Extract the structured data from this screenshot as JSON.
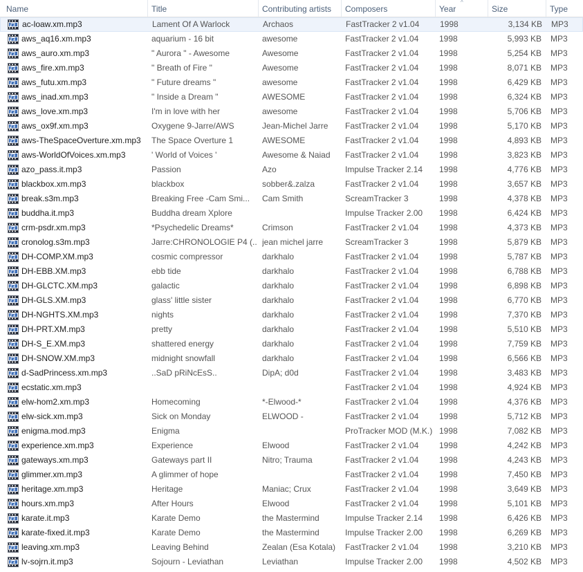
{
  "columns": {
    "name": "Name",
    "title": "Title",
    "artists": "Contributing artists",
    "composers": "Composers",
    "year": "Year",
    "size": "Size",
    "type": "Type"
  },
  "sort_indicator": "^",
  "file_icon": "audio-file-icon",
  "rows": [
    {
      "name": "ac-loaw.xm.mp3",
      "title": "Lament Of A Warlock",
      "artist": "Archaos",
      "composer": "FastTracker 2 v1.04",
      "year": "1998",
      "size": "3,134 KB",
      "type": "MP3"
    },
    {
      "name": "aws_aq16.xm.mp3",
      "title": "aquarium - 16 bit",
      "artist": "awesome",
      "composer": "FastTracker 2 v1.04",
      "year": "1998",
      "size": "5,993 KB",
      "type": "MP3"
    },
    {
      "name": "aws_auro.xm.mp3",
      "title": "\" Aurora \" - Awesome",
      "artist": "Awesome",
      "composer": "FastTracker 2 v1.04",
      "year": "1998",
      "size": "5,254 KB",
      "type": "MP3"
    },
    {
      "name": "aws_fire.xm.mp3",
      "title": "\" Breath of Fire \"",
      "artist": "Awesome",
      "composer": "FastTracker 2 v1.04",
      "year": "1998",
      "size": "8,071 KB",
      "type": "MP3"
    },
    {
      "name": "aws_futu.xm.mp3",
      "title": "\" Future dreams \"",
      "artist": "awesome",
      "composer": "FastTracker 2 v1.04",
      "year": "1998",
      "size": "6,429 KB",
      "type": "MP3"
    },
    {
      "name": "aws_inad.xm.mp3",
      "title": "\" Inside a Dream \"",
      "artist": "AWESOME",
      "composer": "FastTracker 2 v1.04",
      "year": "1998",
      "size": "6,324 KB",
      "type": "MP3"
    },
    {
      "name": "aws_love.xm.mp3",
      "title": "I'm in love with her",
      "artist": "awesome",
      "composer": "FastTracker 2 v1.04",
      "year": "1998",
      "size": "5,706 KB",
      "type": "MP3"
    },
    {
      "name": "aws_ox9f.xm.mp3",
      "title": "Oxygene 9-Jarre/AWS",
      "artist": "Jean-Michel Jarre",
      "composer": "FastTracker 2 v1.04",
      "year": "1998",
      "size": "5,170 KB",
      "type": "MP3"
    },
    {
      "name": "aws-TheSpaceOverture.xm.mp3",
      "title": "The Space Overture 1",
      "artist": "AWESOME",
      "composer": "FastTracker 2 v1.04",
      "year": "1998",
      "size": "4,893 KB",
      "type": "MP3"
    },
    {
      "name": "aws-WorldOfVoices.xm.mp3",
      "title": "' World of Voices '",
      "artist": "Awesome & Naiad",
      "composer": "FastTracker 2 v1.04",
      "year": "1998",
      "size": "3,823 KB",
      "type": "MP3"
    },
    {
      "name": "azo_pass.it.mp3",
      "title": "Passion",
      "artist": "Azo",
      "composer": "Impulse Tracker 2.14",
      "year": "1998",
      "size": "4,776 KB",
      "type": "MP3"
    },
    {
      "name": "blackbox.xm.mp3",
      "title": "blackbox",
      "artist": "sobber&.zalza",
      "composer": "FastTracker 2 v1.04",
      "year": "1998",
      "size": "3,657 KB",
      "type": "MP3"
    },
    {
      "name": "break.s3m.mp3",
      "title": "Breaking Free    -Cam Smi...",
      "artist": "Cam Smith",
      "composer": "ScreamTracker 3",
      "year": "1998",
      "size": "4,378 KB",
      "type": "MP3"
    },
    {
      "name": "buddha.it.mp3",
      "title": "Buddha dream       Xplore",
      "artist": "",
      "composer": "Impulse Tracker 2.00",
      "year": "1998",
      "size": "6,424 KB",
      "type": "MP3"
    },
    {
      "name": "crm-psdr.xm.mp3",
      "title": "*Psychedelic Dreams*",
      "artist": "Crimson",
      "composer": "FastTracker 2 v1.04",
      "year": "1998",
      "size": "4,373 KB",
      "type": "MP3"
    },
    {
      "name": "cronolog.s3m.mp3",
      "title": "Jarre:CHRONOLOGIE P4 (...",
      "artist": "jean michel jarre",
      "composer": "ScreamTracker 3",
      "year": "1998",
      "size": "5,879 KB",
      "type": "MP3"
    },
    {
      "name": "DH-COMP.XM.mp3",
      "title": "cosmic compressor",
      "artist": "darkhalo",
      "composer": "FastTracker 2 v1.04",
      "year": "1998",
      "size": "5,787 KB",
      "type": "MP3"
    },
    {
      "name": "DH-EBB.XM.mp3",
      "title": "ebb tide",
      "artist": "darkhalo",
      "composer": "FastTracker 2 v1.04",
      "year": "1998",
      "size": "6,788 KB",
      "type": "MP3"
    },
    {
      "name": "DH-GLCTC.XM.mp3",
      "title": "galactic",
      "artist": "darkhalo",
      "composer": "FastTracker 2 v1.04",
      "year": "1998",
      "size": "6,898 KB",
      "type": "MP3"
    },
    {
      "name": "DH-GLS.XM.mp3",
      "title": "glass' little sister",
      "artist": "darkhalo",
      "composer": "FastTracker 2 v1.04",
      "year": "1998",
      "size": "6,770 KB",
      "type": "MP3"
    },
    {
      "name": "DH-NGHTS.XM.mp3",
      "title": "nights",
      "artist": "darkhalo",
      "composer": "FastTracker 2 v1.04",
      "year": "1998",
      "size": "7,370 KB",
      "type": "MP3"
    },
    {
      "name": "DH-PRT.XM.mp3",
      "title": "pretty",
      "artist": "darkhalo",
      "composer": "FastTracker 2 v1.04",
      "year": "1998",
      "size": "5,510 KB",
      "type": "MP3"
    },
    {
      "name": "DH-S_E.XM.mp3",
      "title": "shattered energy",
      "artist": "darkhalo",
      "composer": "FastTracker 2 v1.04",
      "year": "1998",
      "size": "7,759 KB",
      "type": "MP3"
    },
    {
      "name": "DH-SNOW.XM.mp3",
      "title": "midnight snowfall",
      "artist": "darkhalo",
      "composer": "FastTracker 2 v1.04",
      "year": "1998",
      "size": "6,566 KB",
      "type": "MP3"
    },
    {
      "name": "d-SadPrincess.xm.mp3",
      "title": "..SaD pRiNcEsS..",
      "artist": "DipA; d0d",
      "composer": "FastTracker 2 v1.04",
      "year": "1998",
      "size": "3,483 KB",
      "type": "MP3"
    },
    {
      "name": "ecstatic.xm.mp3",
      "title": "",
      "artist": "",
      "composer": "FastTracker 2 v1.04",
      "year": "1998",
      "size": "4,924 KB",
      "type": "MP3"
    },
    {
      "name": "elw-hom2.xm.mp3",
      "title": "Homecoming",
      "artist": "*-Elwood-*",
      "composer": "FastTracker 2 v1.04",
      "year": "1998",
      "size": "4,376 KB",
      "type": "MP3"
    },
    {
      "name": "elw-sick.xm.mp3",
      "title": "Sick on Monday",
      "artist": "ELWOOD -",
      "composer": "FastTracker 2 v1.04",
      "year": "1998",
      "size": "5,712 KB",
      "type": "MP3"
    },
    {
      "name": "enigma.mod.mp3",
      "title": "Enigma",
      "artist": "",
      "composer": "ProTracker MOD (M.K.)",
      "year": "1998",
      "size": "7,082 KB",
      "type": "MP3"
    },
    {
      "name": "experience.xm.mp3",
      "title": "Experience",
      "artist": "Elwood",
      "composer": "FastTracker 2 v1.04",
      "year": "1998",
      "size": "4,242 KB",
      "type": "MP3"
    },
    {
      "name": "gateways.xm.mp3",
      "title": "Gateways part II",
      "artist": "Nitro; Trauma",
      "composer": "FastTracker 2 v1.04",
      "year": "1998",
      "size": "4,243 KB",
      "type": "MP3"
    },
    {
      "name": "glimmer.xm.mp3",
      "title": "A glimmer of hope",
      "artist": "",
      "composer": "FastTracker 2 v1.04",
      "year": "1998",
      "size": "7,450 KB",
      "type": "MP3"
    },
    {
      "name": "heritage.xm.mp3",
      "title": "Heritage",
      "artist": "Maniac; Crux",
      "composer": "FastTracker 2 v1.04",
      "year": "1998",
      "size": "3,649 KB",
      "type": "MP3"
    },
    {
      "name": "hours.xm.mp3",
      "title": "After Hours",
      "artist": "Elwood",
      "composer": "FastTracker 2 v1.04",
      "year": "1998",
      "size": "5,101 KB",
      "type": "MP3"
    },
    {
      "name": "karate.it.mp3",
      "title": "Karate Demo",
      "artist": "the Mastermind",
      "composer": "Impulse Tracker 2.14",
      "year": "1998",
      "size": "6,426 KB",
      "type": "MP3"
    },
    {
      "name": "karate-fixed.it.mp3",
      "title": "Karate Demo",
      "artist": "the Mastermind",
      "composer": "Impulse Tracker 2.00",
      "year": "1998",
      "size": "6,269 KB",
      "type": "MP3"
    },
    {
      "name": "leaving.xm.mp3",
      "title": "Leaving Behind",
      "artist": "Zealan  (Esa Kotala)",
      "composer": "FastTracker 2 v1.04",
      "year": "1998",
      "size": "3,210 KB",
      "type": "MP3"
    },
    {
      "name": "lv-sojrn.it.mp3",
      "title": "Sojourn - Leviathan",
      "artist": "Leviathan",
      "composer": "Impulse Tracker 2.00",
      "year": "1998",
      "size": "4,502 KB",
      "type": "MP3"
    }
  ]
}
